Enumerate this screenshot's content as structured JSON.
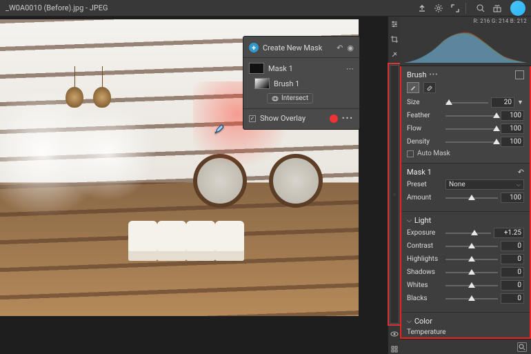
{
  "top": {
    "filename": "_W0A0010 (Before).jpg  -  JPEG"
  },
  "maskpanel": {
    "create": "Create New Mask",
    "mask1": "Mask 1",
    "brush1": "Brush 1",
    "intersect": "Intersect",
    "show_overlay": "Show Overlay"
  },
  "histogram": {
    "readout": "R: 216   G: 214   B: 212"
  },
  "brush": {
    "title": "Brush",
    "size_label": "Size",
    "size_value": "20",
    "feather_label": "Feather",
    "feather_value": "100",
    "flow_label": "Flow",
    "flow_value": "100",
    "density_label": "Density",
    "density_value": "100",
    "auto_mask": "Auto Mask"
  },
  "maskadj": {
    "title": "Mask 1",
    "preset_label": "Preset",
    "preset_value": "None",
    "amount_label": "Amount",
    "amount_value": "100"
  },
  "light": {
    "title": "Light",
    "exposure_label": "Exposure",
    "exposure_value": "+1.25",
    "contrast_label": "Contrast",
    "contrast_value": "0",
    "highlights_label": "Highlights",
    "highlights_value": "0",
    "shadows_label": "Shadows",
    "shadows_value": "0",
    "whites_label": "Whites",
    "whites_value": "0",
    "blacks_label": "Blacks",
    "blacks_value": "0"
  },
  "color": {
    "title": "Color",
    "temperature_label": "Temperature"
  }
}
